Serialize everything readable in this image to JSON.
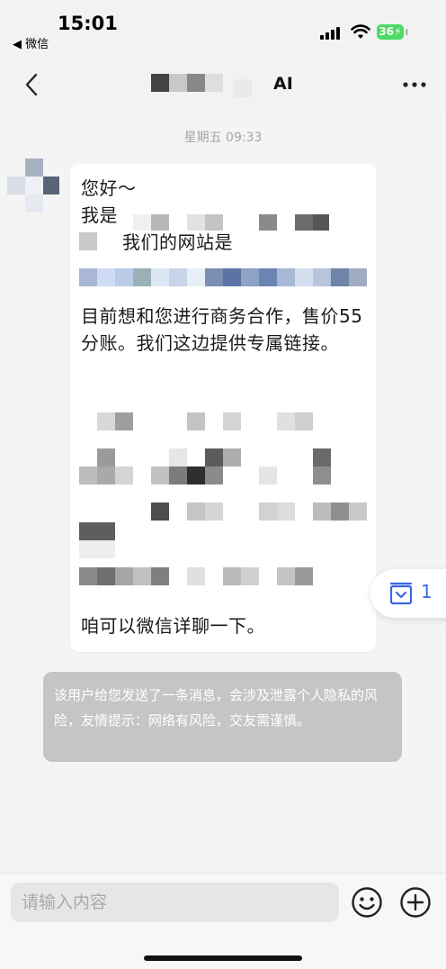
{
  "status_bar": {
    "time": "15:01",
    "back_app": "◀ 微信",
    "battery": "36"
  },
  "header": {
    "title_visible": "AI",
    "back_icon": "chevron-left-icon",
    "more_icon": "more-dots-icon"
  },
  "chat": {
    "timestamp": "星期五 09:33",
    "message": {
      "line1": "您好～",
      "line2": "我是",
      "line3": "我们的网站是",
      "paragraph": "目前想和您进行商务合作，售价55分账。我们这边提供专属链接。",
      "closing": "咱可以微信详聊一下。"
    },
    "system_notice": "该用户给您发送了一条消息，会涉及泄露个人隐私的风险，友情提示：网络有风险，交友需谨慎。",
    "float_badge": {
      "icon": "inbox-icon",
      "count": "1"
    }
  },
  "input_bar": {
    "placeholder": "请输入内容",
    "emoji_icon": "emoji-icon",
    "plus_icon": "plus-icon"
  },
  "colors": {
    "accent": "#3a66e6",
    "battery": "#4cd964",
    "notice_bg": "#c5c5c5"
  }
}
